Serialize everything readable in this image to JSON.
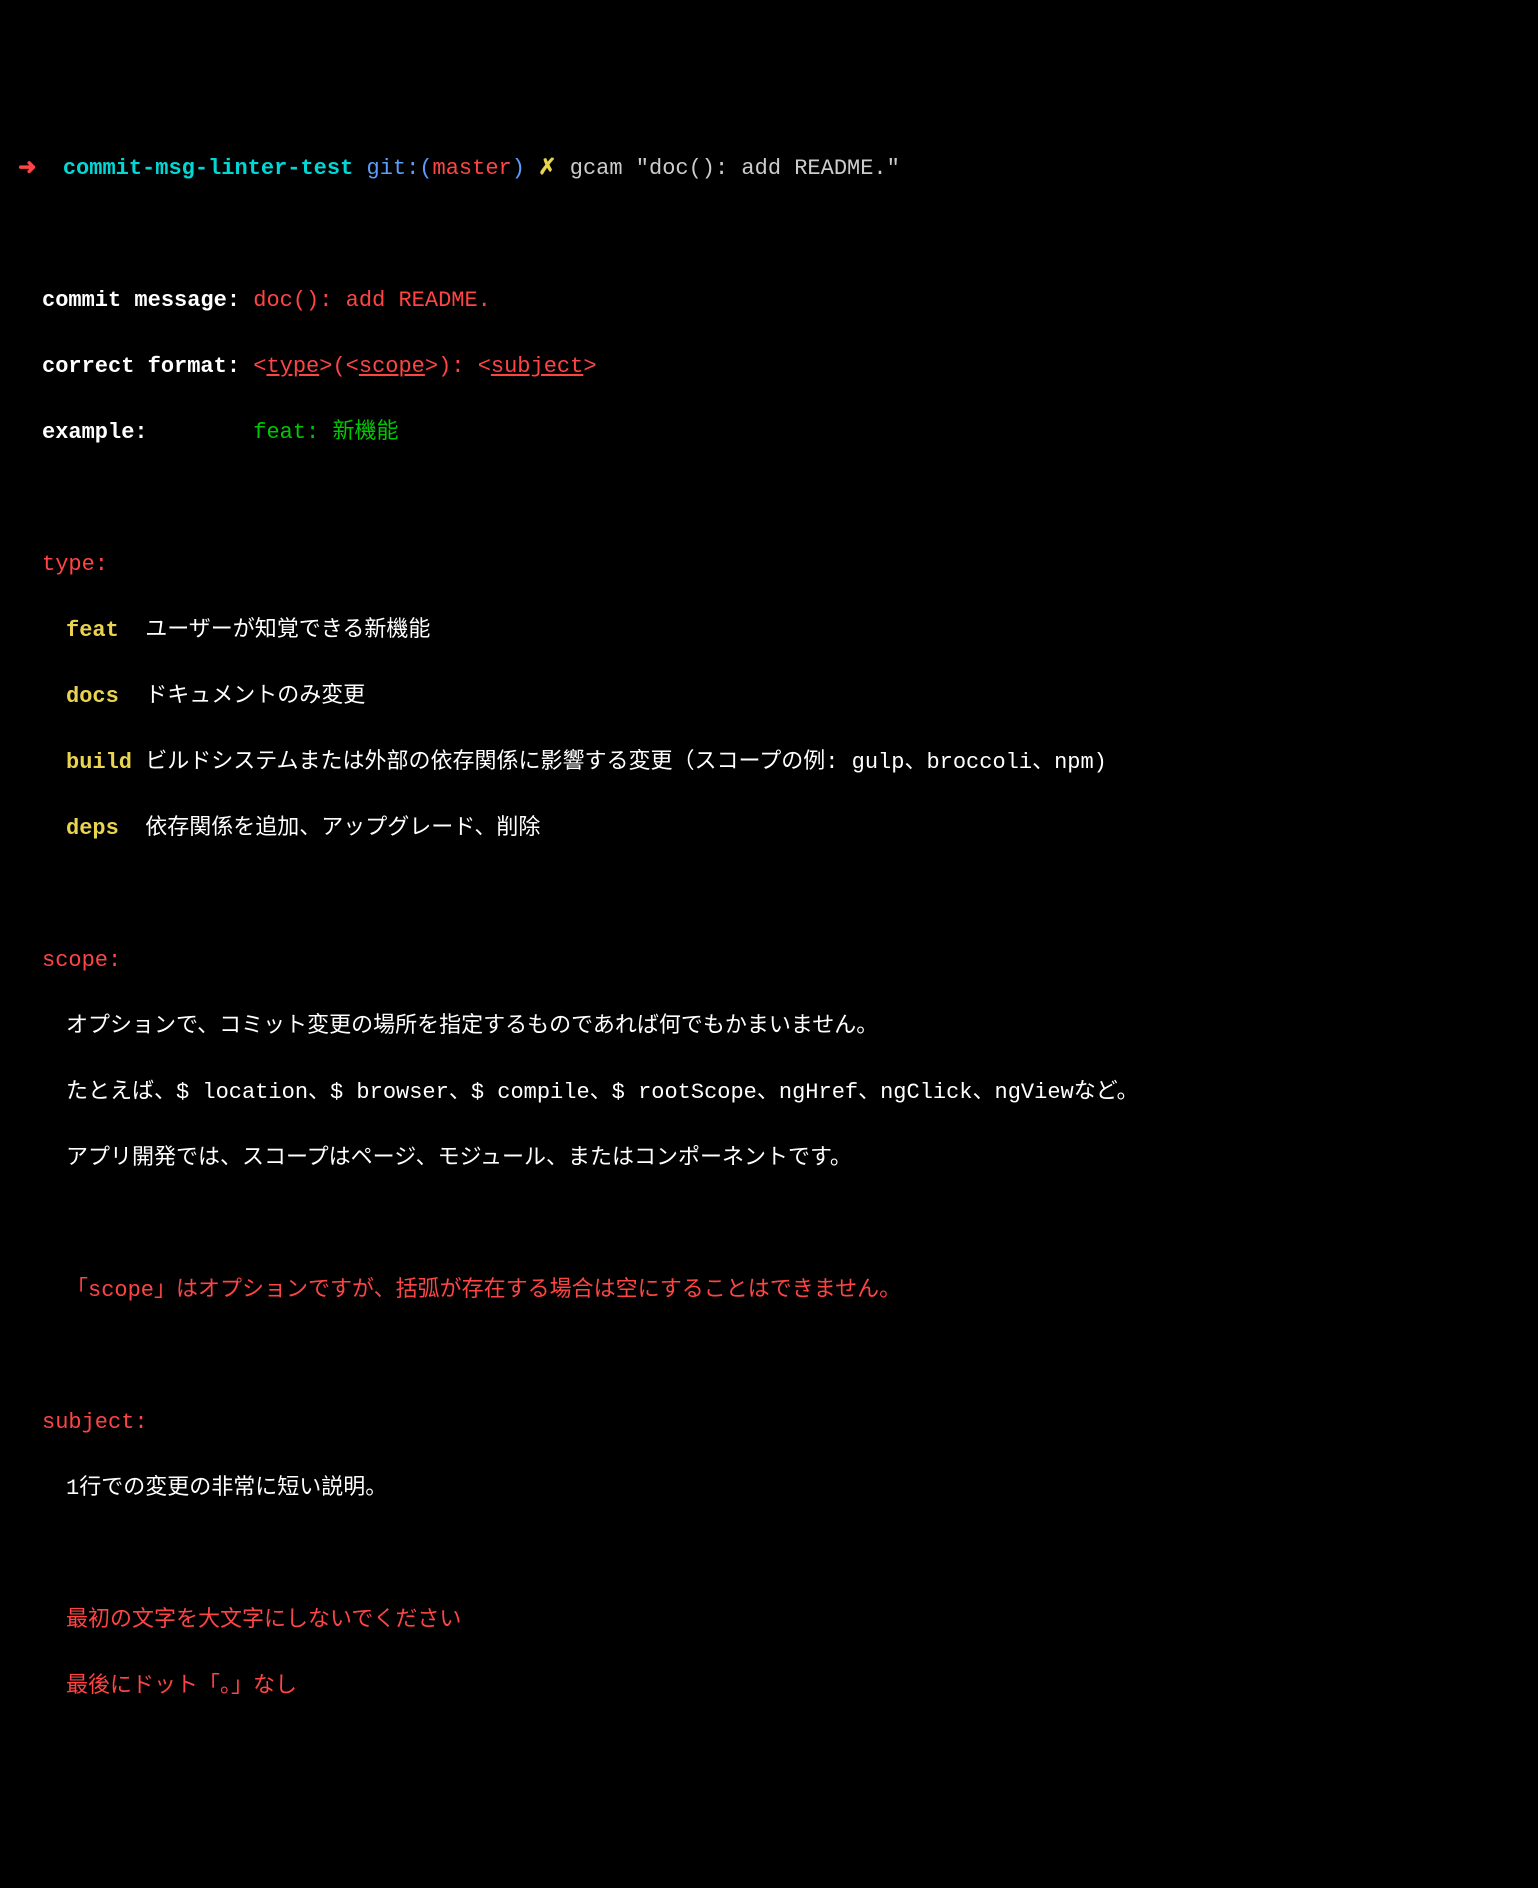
{
  "prompt": {
    "arrow": "➜",
    "dir": "commit-msg-linter-test",
    "gitPrefix": "git:(",
    "branch": "master",
    "gitSuffix": ")",
    "dirty": "✗",
    "cmd": "gcam \"doc(): add README.\""
  },
  "labels": {
    "commitMessage": "commit message:",
    "correctFormat": "correct format:",
    "example": "example:"
  },
  "values": {
    "commitMessage": "doc(): add README.",
    "formatLeftAngle": "<",
    "formatType": "type",
    "formatMid1": ">(<",
    "formatScope": "scope",
    "formatMid2": ">): <",
    "formatSubject": "subject",
    "formatRightAngle": ">",
    "exampleType": "feat:",
    "exampleDesc": "新機能"
  },
  "sections": {
    "type": {
      "header": "type:",
      "items": [
        {
          "name": "feat ",
          "desc": " ユーザーが知覚できる新機能"
        },
        {
          "name": "docs ",
          "desc": " ドキュメントのみ変更"
        },
        {
          "name": "build",
          "desc": " ビルドシステムまたは外部の依存関係に影響する変更（スコープの例: gulp、broccoli、npm)"
        },
        {
          "name": "deps ",
          "desc": " 依存関係を追加、アップグレード、削除"
        }
      ]
    },
    "scope": {
      "header": "scope:",
      "lines": [
        "オプションで、コミット変更の場所を指定するものであれば何でもかまいません。",
        "たとえば、$ location、$ browser、$ compile、$ rootScope、ngHref、ngClick、ngViewなど。",
        "アプリ開発では、スコープはページ、モジュール、またはコンポーネントです。"
      ],
      "warn": "「scope」はオプションですが、括弧が存在する場合は空にすることはできません。"
    },
    "subject": {
      "header": "subject:",
      "line": "1行での変更の非常に短い説明。",
      "warn1": "最初の文字を大文字にしないでください",
      "warn2": "最後にドット「。」なし"
    }
  }
}
